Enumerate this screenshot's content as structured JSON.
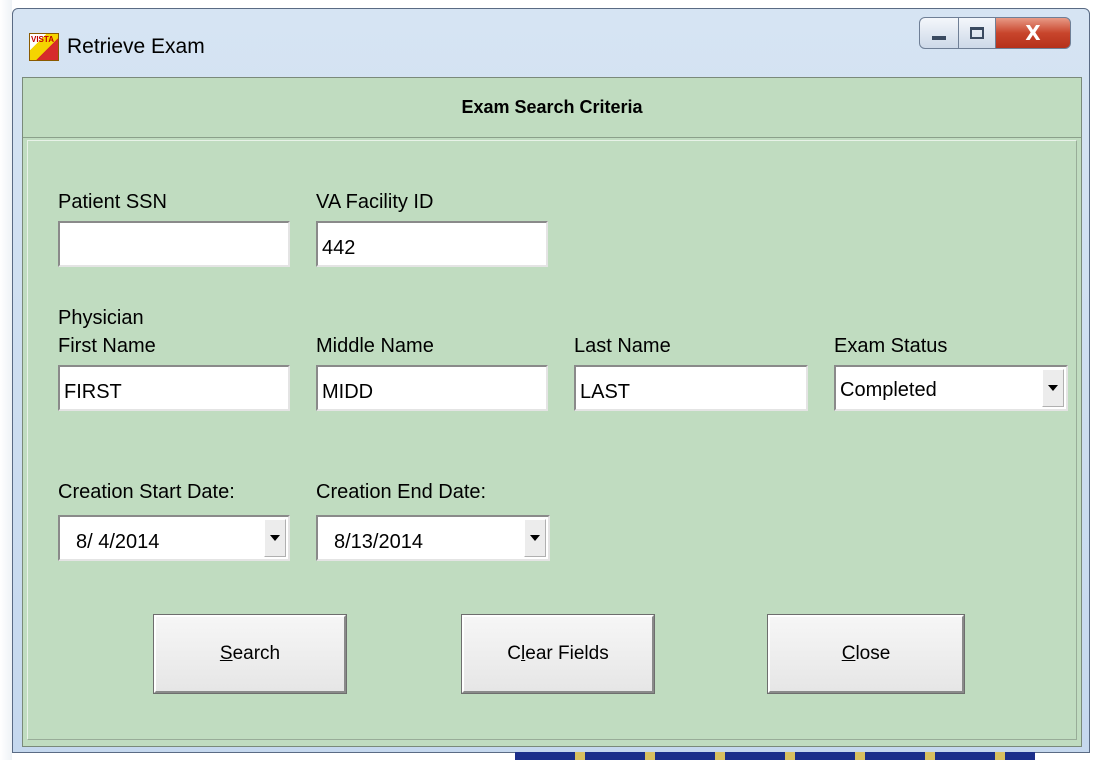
{
  "window": {
    "title": "Retrieve Exam",
    "icon": "vista-app-icon",
    "icon_text": "VISTA"
  },
  "header": {
    "title": "Exam Search Criteria"
  },
  "form": {
    "patient_ssn": {
      "label": "Patient SSN",
      "value": ""
    },
    "va_facility_id": {
      "label": "VA Facility ID",
      "value": "442"
    },
    "physician_group_label": "Physician",
    "first_name": {
      "label": "First Name",
      "value": "FIRST"
    },
    "middle_name": {
      "label": "Middle Name",
      "value": "MIDD"
    },
    "last_name": {
      "label": "Last Name",
      "value": "LAST"
    },
    "exam_status": {
      "label": "Exam Status",
      "value": "Completed"
    },
    "creation_start_date": {
      "label": "Creation Start Date:",
      "value": "8/ 4/2014"
    },
    "creation_end_date": {
      "label": "Creation End Date:",
      "value": "8/13/2014"
    }
  },
  "buttons": {
    "search": "Search",
    "clear_fields": "Clear Fields",
    "close": "Close"
  },
  "colors": {
    "client_background": "#c0dcc0",
    "close_button": "#c8452c"
  }
}
